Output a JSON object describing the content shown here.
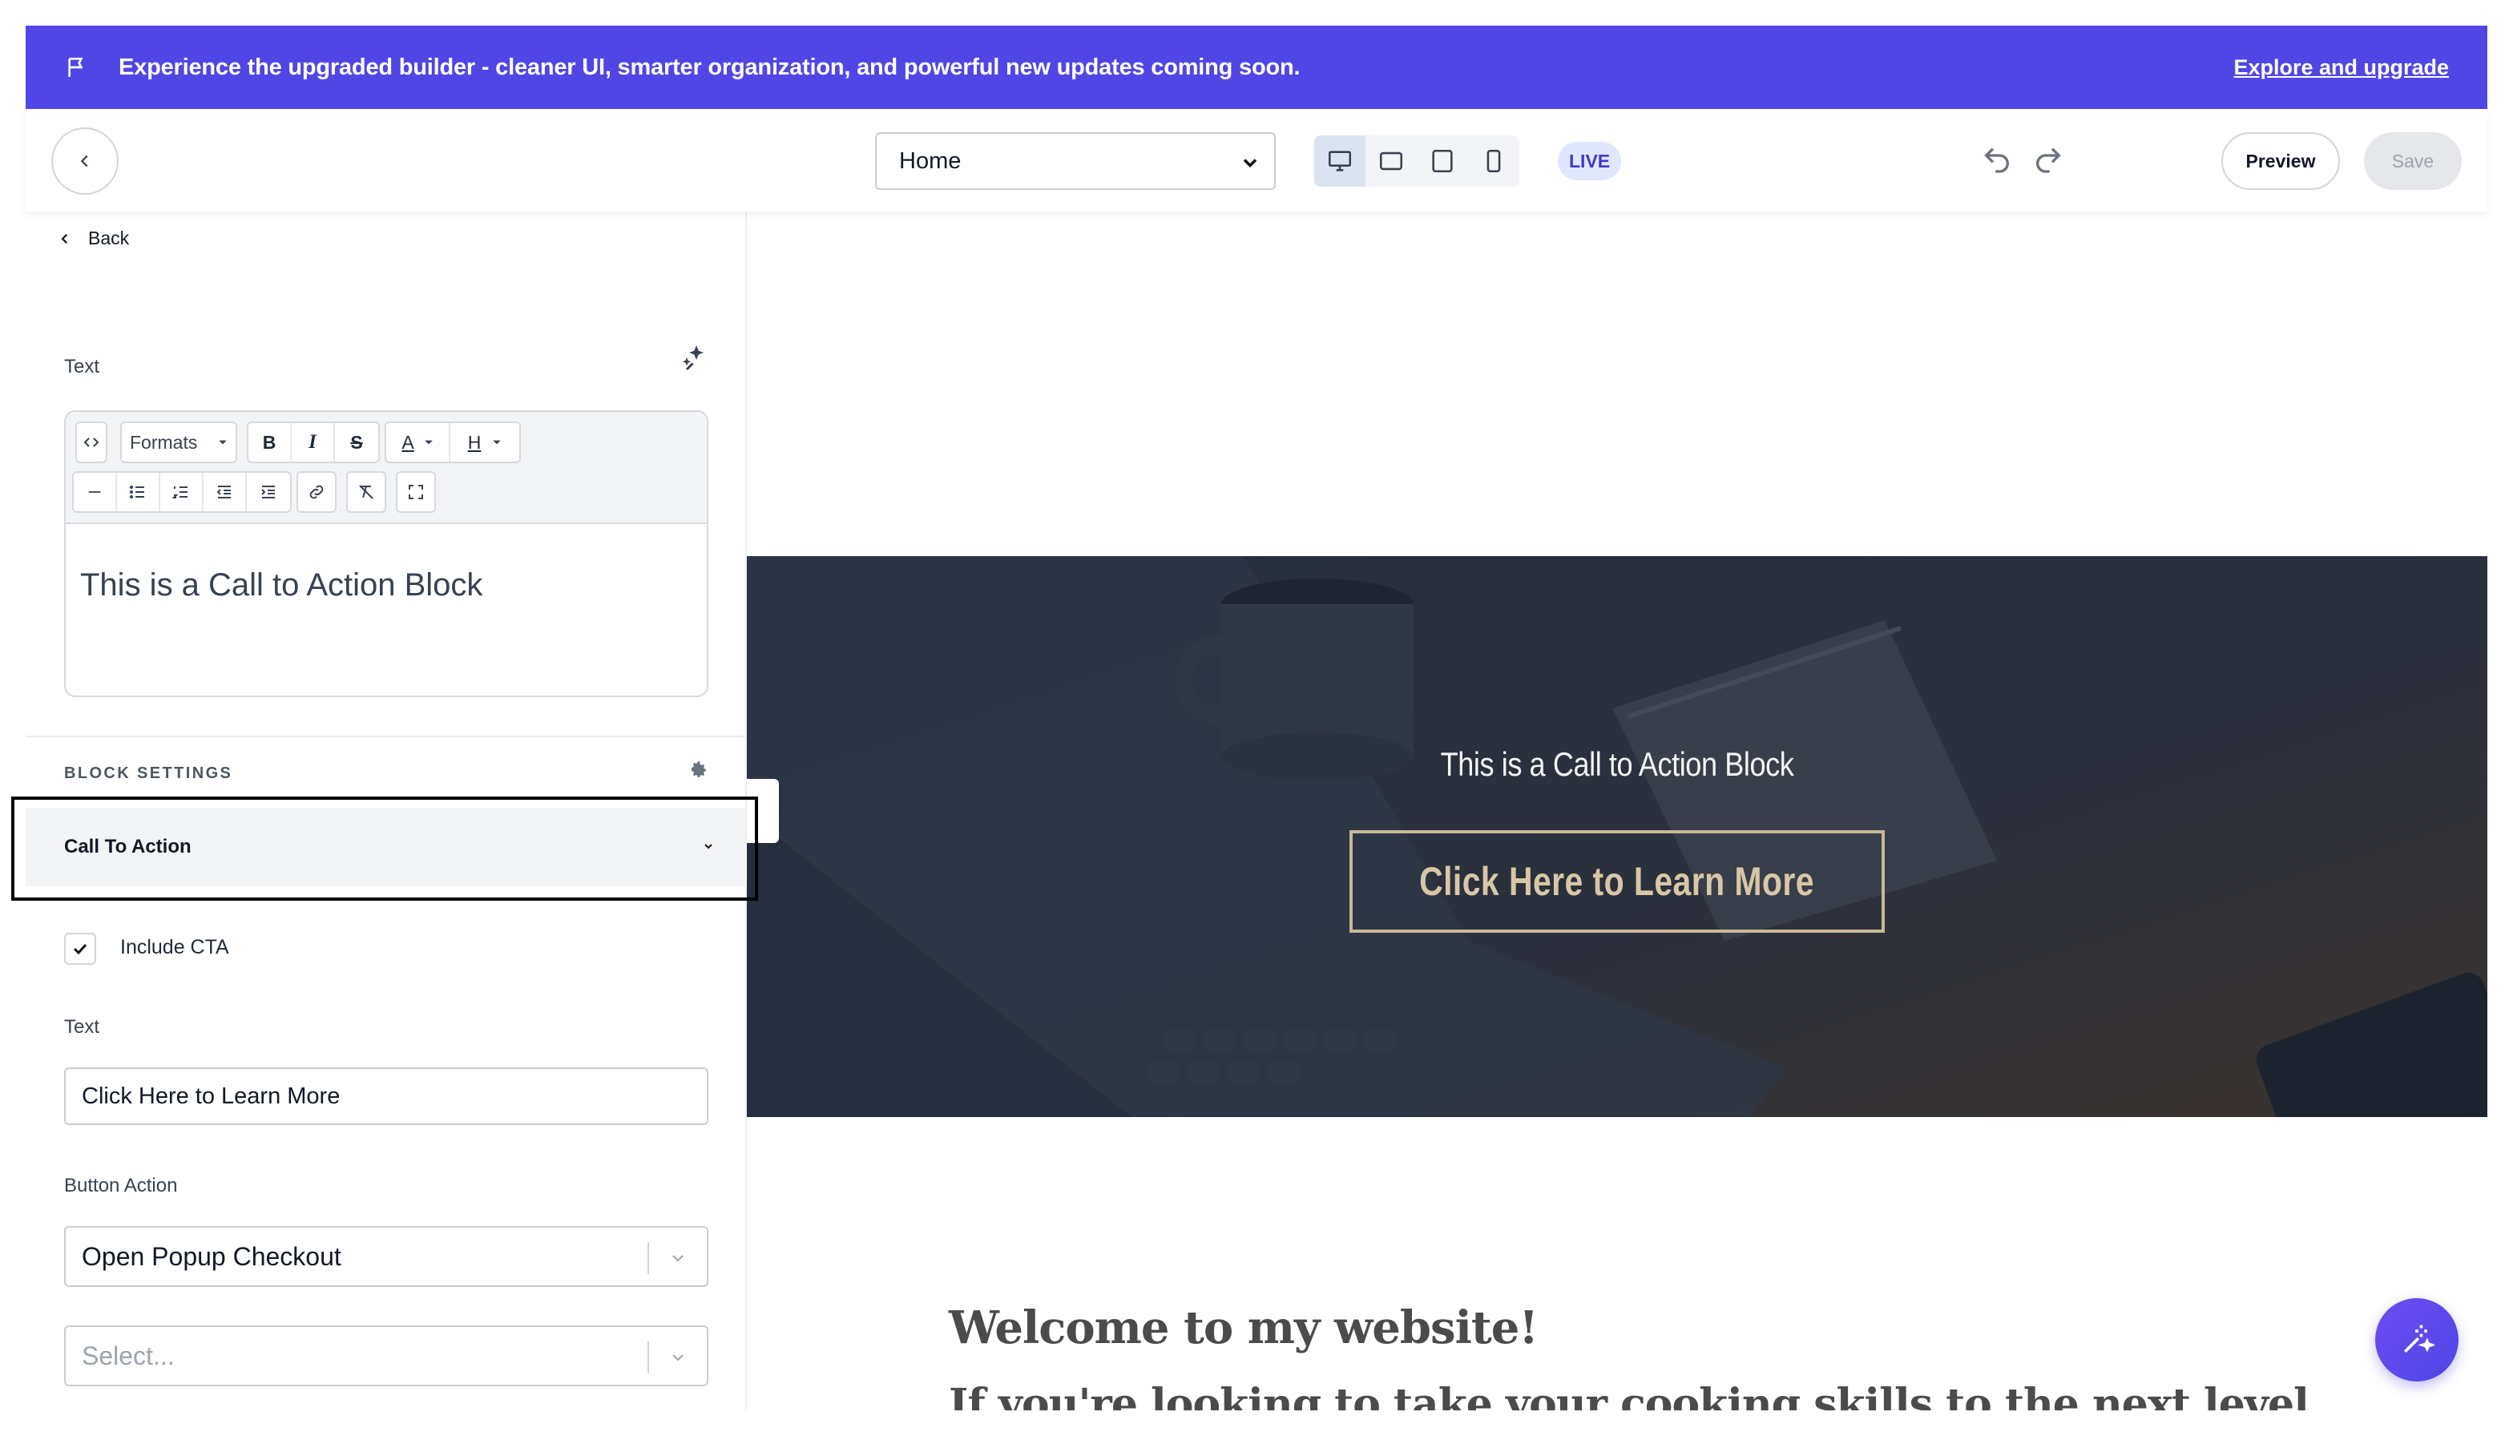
{
  "banner": {
    "message": "Experience the upgraded builder - cleaner UI, smarter organization, and powerful new updates coming soon.",
    "link": "Explore and upgrade",
    "color": "#5046e5"
  },
  "toolbar": {
    "page_select": "Home",
    "devices": [
      "desktop-icon",
      "tablet-landscape-icon",
      "tablet-portrait-icon",
      "mobile-icon"
    ],
    "active_device": "desktop",
    "status_badge": "LIVE",
    "preview_label": "Preview",
    "save_label": "Save"
  },
  "panel": {
    "back_label": "Back",
    "text_label": "Text",
    "editor": {
      "formats_label": "Formats",
      "bold": "B",
      "italic": "I",
      "strike": "S",
      "font_color": "A",
      "heading": "H",
      "content": "This is a Call to Action Block"
    },
    "block_settings_label": "BLOCK SETTINGS",
    "accordion_label": "Call To Action",
    "include_cta_label": "Include CTA",
    "include_cta_checked": true,
    "cta_text_label": "Text",
    "cta_text_value": "Click Here to Learn More",
    "button_action_label": "Button Action",
    "button_action_value": "Open Popup Checkout",
    "second_select_placeholder": "Select..."
  },
  "canvas": {
    "hero_title": "This is a Call to Action Block",
    "hero_button": "Click Here to Learn More",
    "welcome_heading": "Welcome to my website!",
    "welcome_sub": "If you're looking to take your cooking skills to the next level"
  }
}
